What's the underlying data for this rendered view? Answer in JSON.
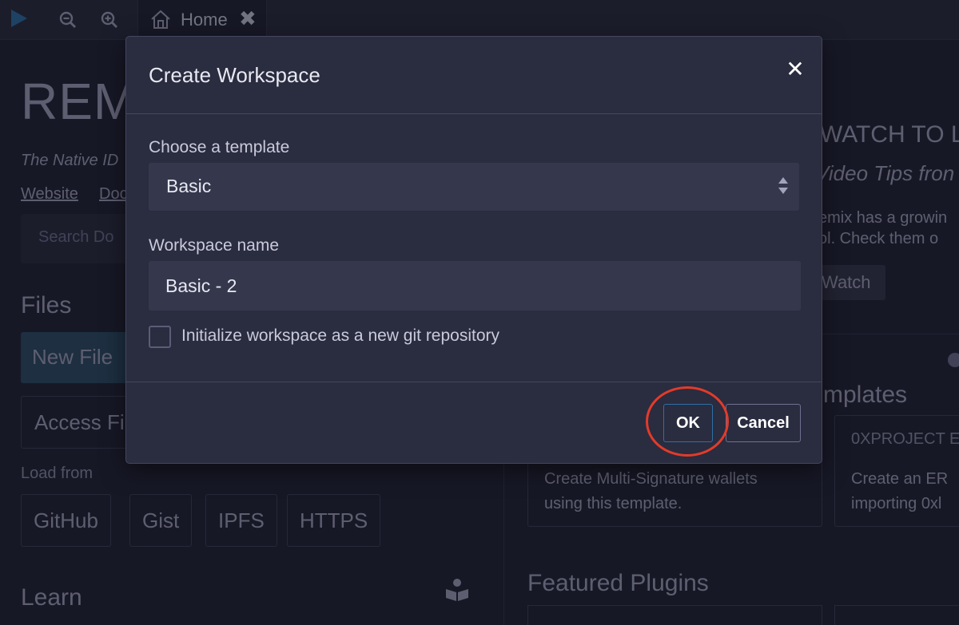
{
  "topbar": {
    "icons": [
      "play-icon",
      "zoom-out-icon",
      "zoom-in-icon"
    ],
    "tab": {
      "label": "Home",
      "icon": "home-icon"
    }
  },
  "background_left": {
    "title": "REM",
    "tagline": "The Native ID",
    "links": [
      "Website",
      "Doc"
    ],
    "search_placeholder": "Search Do",
    "files_title": "Files",
    "new_file": "New File",
    "access_file": "Access Fi",
    "load_from": "Load from",
    "load_buttons": [
      "GitHub",
      "Gist",
      "IPFS",
      "HTTPS"
    ],
    "learn_title": "Learn"
  },
  "background_right": {
    "watch_title": "WATCH TO L",
    "video_tips": "Video Tips fron",
    "desc_line1": "emix has a growin",
    "desc_line2": "ol. Check them o",
    "watch_button": "Watch",
    "templates_title": "mplates",
    "card1_desc_line1": "Create Multi-Signature wallets",
    "card1_desc_line2": "using this template.",
    "card2_title": "0XPROJECT E",
    "card2_desc_line1": "Create an ER",
    "card2_desc_line2": "importing 0xl",
    "featured_title": "Featured Plugins"
  },
  "modal": {
    "title": "Create Workspace",
    "close_icon": "close-icon",
    "template_label": "Choose a template",
    "template_value": "Basic",
    "workspace_label": "Workspace name",
    "workspace_value": "Basic - 2",
    "git_checkbox_label": "Initialize workspace as a new git repository",
    "git_checked": false,
    "ok_label": "OK",
    "cancel_label": "Cancel"
  },
  "colors": {
    "background": "#222336",
    "panel": "#2a2c3f",
    "accent": "#2f6fa6",
    "highlight_ring": "#e23b2a"
  }
}
